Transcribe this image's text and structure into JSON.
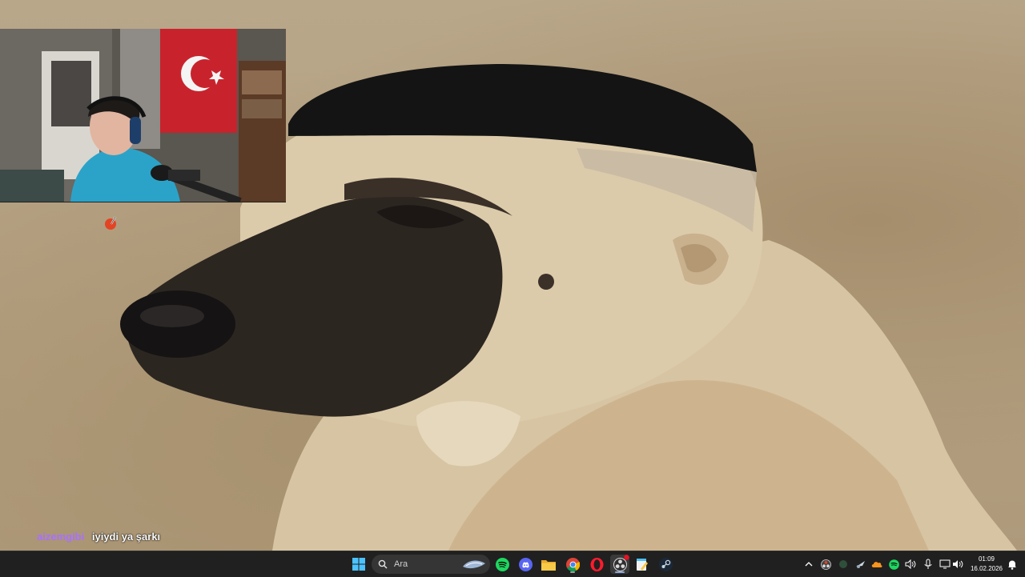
{
  "stream": {
    "chat": {
      "username": "aizemgibi",
      "message": "iyiydi ya şarkı",
      "username_color": "#a970ff"
    }
  },
  "taskbar": {
    "search_placeholder": "Ara",
    "pinned_apps": [
      {
        "name": "start",
        "icon": "windows-logo-icon"
      },
      {
        "name": "spotify",
        "icon": "spotify-icon"
      },
      {
        "name": "discord",
        "icon": "discord-icon"
      },
      {
        "name": "file-explorer",
        "icon": "folder-icon"
      },
      {
        "name": "chrome",
        "icon": "chrome-icon"
      },
      {
        "name": "opera",
        "icon": "opera-icon"
      },
      {
        "name": "obs",
        "icon": "obs-icon"
      },
      {
        "name": "notes",
        "icon": "notepad-icon"
      },
      {
        "name": "steam",
        "icon": "steam-icon"
      }
    ],
    "tray_icons": [
      "chevron-up-icon",
      "obs-tray-icon",
      "app-tray-icon",
      "steam-tray-icon",
      "cloud-icon",
      "spotify-tray-icon",
      "speaker-icon",
      "microphone-icon",
      "display-icon",
      "volume-icon"
    ],
    "clock": {
      "time": "01:09",
      "date": "16.02.2026"
    }
  },
  "colors": {
    "taskbar_bg": "#202020",
    "accent": "#0078d4"
  }
}
